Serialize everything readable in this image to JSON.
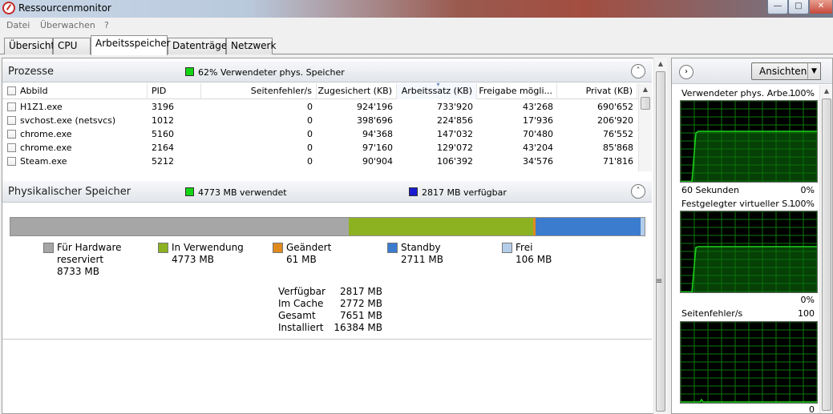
{
  "window": {
    "title": "Ressourcenmonitor"
  },
  "menu": [
    "Datei",
    "Überwachen",
    "?"
  ],
  "tabs": [
    "Übersicht",
    "CPU",
    "Arbeitsspeicher",
    "Datenträger",
    "Netzwerk"
  ],
  "active_tab": "Arbeitsspeicher",
  "processes": {
    "title": "Prozesse",
    "summary": "62% Verwendeter phys. Speicher",
    "columns": [
      "Abbild",
      "PID",
      "Seitenfehler/s",
      "Zugesichert (KB)",
      "Arbeitssatz (KB)",
      "Freigabe mögli...",
      "Privat (KB)"
    ],
    "rows": [
      [
        "H1Z1.exe",
        "3196",
        "0",
        "924'196",
        "733'920",
        "43'268",
        "690'652"
      ],
      [
        "svchost.exe (netsvcs)",
        "1012",
        "0",
        "398'696",
        "224'856",
        "17'936",
        "206'920"
      ],
      [
        "chrome.exe",
        "5160",
        "0",
        "94'368",
        "147'032",
        "70'480",
        "76'552"
      ],
      [
        "chrome.exe",
        "2164",
        "0",
        "97'160",
        "129'072",
        "43'204",
        "85'868"
      ],
      [
        "Steam.exe",
        "5212",
        "0",
        "90'904",
        "106'392",
        "34'576",
        "71'816"
      ]
    ]
  },
  "physical": {
    "title": "Physikalischer Speicher",
    "used": "4773 MB verwendet",
    "available": "2817 MB verfügbar",
    "legend": [
      {
        "label": "Für Hardware",
        "label2": "reserviert",
        "value": "8733 MB",
        "color": "#a6a6a6"
      },
      {
        "label": "In Verwendung",
        "value": "4773 MB",
        "color": "#8db221"
      },
      {
        "label": "Geändert",
        "value": "61 MB",
        "color": "#e08a1e"
      },
      {
        "label": "Standby",
        "value": "2711 MB",
        "color": "#3b7ccf"
      },
      {
        "label": "Frei",
        "value": "106 MB",
        "color": "#b4cde9"
      }
    ],
    "bar_mb": {
      "hardware": 8733,
      "in_use": 4773,
      "modified": 61,
      "standby": 2711,
      "free": 106
    },
    "stats": [
      {
        "k": "Verfügbar",
        "v": "2817 MB"
      },
      {
        "k": "Im Cache",
        "v": "2772 MB"
      },
      {
        "k": "Gesamt",
        "v": "7651 MB"
      },
      {
        "k": "Installiert",
        "v": "16384 MB"
      }
    ]
  },
  "right": {
    "views_button": "Ansichten",
    "graphs": [
      {
        "title": "Verwendeter phys. Arbe...",
        "max": "100%",
        "footer_left": "60 Sekunden",
        "footer_right": "0%"
      },
      {
        "title": "Festgelegter virtueller S...",
        "max": "100%",
        "footer_left": "",
        "footer_right": "0%"
      },
      {
        "title": "Seitenfehler/s",
        "max": "100",
        "footer_left": "",
        "footer_right": "0"
      }
    ]
  },
  "colors": {
    "graph_line": "#1cd41c",
    "graph_grid": "#0c7a0c",
    "graph_fill": "#0a6a0a"
  }
}
